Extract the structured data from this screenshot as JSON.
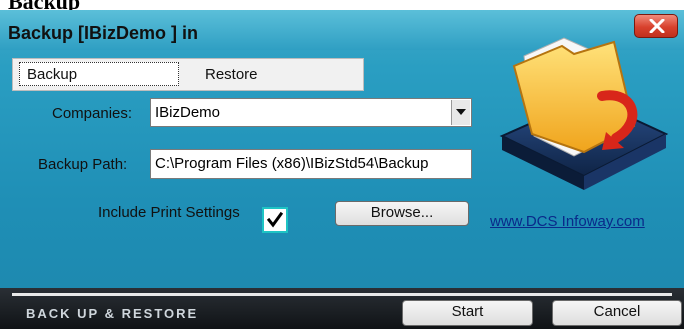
{
  "page": {
    "heading": "Backup"
  },
  "window": {
    "title": "Backup [IBizDemo ] in",
    "tabs": [
      {
        "label": "Backup",
        "selected": true
      },
      {
        "label": "Restore",
        "selected": false
      }
    ]
  },
  "form": {
    "companies_label": "Companies:",
    "companies_value": "IBizDemo",
    "backup_path_label": "Backup Path:",
    "backup_path_value": "C:\\Program Files (x86)\\IBizStd54\\Backup",
    "include_print_label": "Include Print Settings",
    "include_print_checked": true,
    "browse_label": "Browse...",
    "link_text": "www.DCS Infoway.com"
  },
  "footer": {
    "caption": "Back Up & Restore",
    "start_label": "Start",
    "cancel_label": "Cancel"
  },
  "colors": {
    "window_bg": "#1f8fb6",
    "close_red": "#d8412d",
    "footer_bg": "#1a1e22",
    "link": "#0a2a8a"
  },
  "icons": [
    "close-icon",
    "dropdown-arrow-icon",
    "checkmark-icon",
    "folder-backup-icon"
  ]
}
